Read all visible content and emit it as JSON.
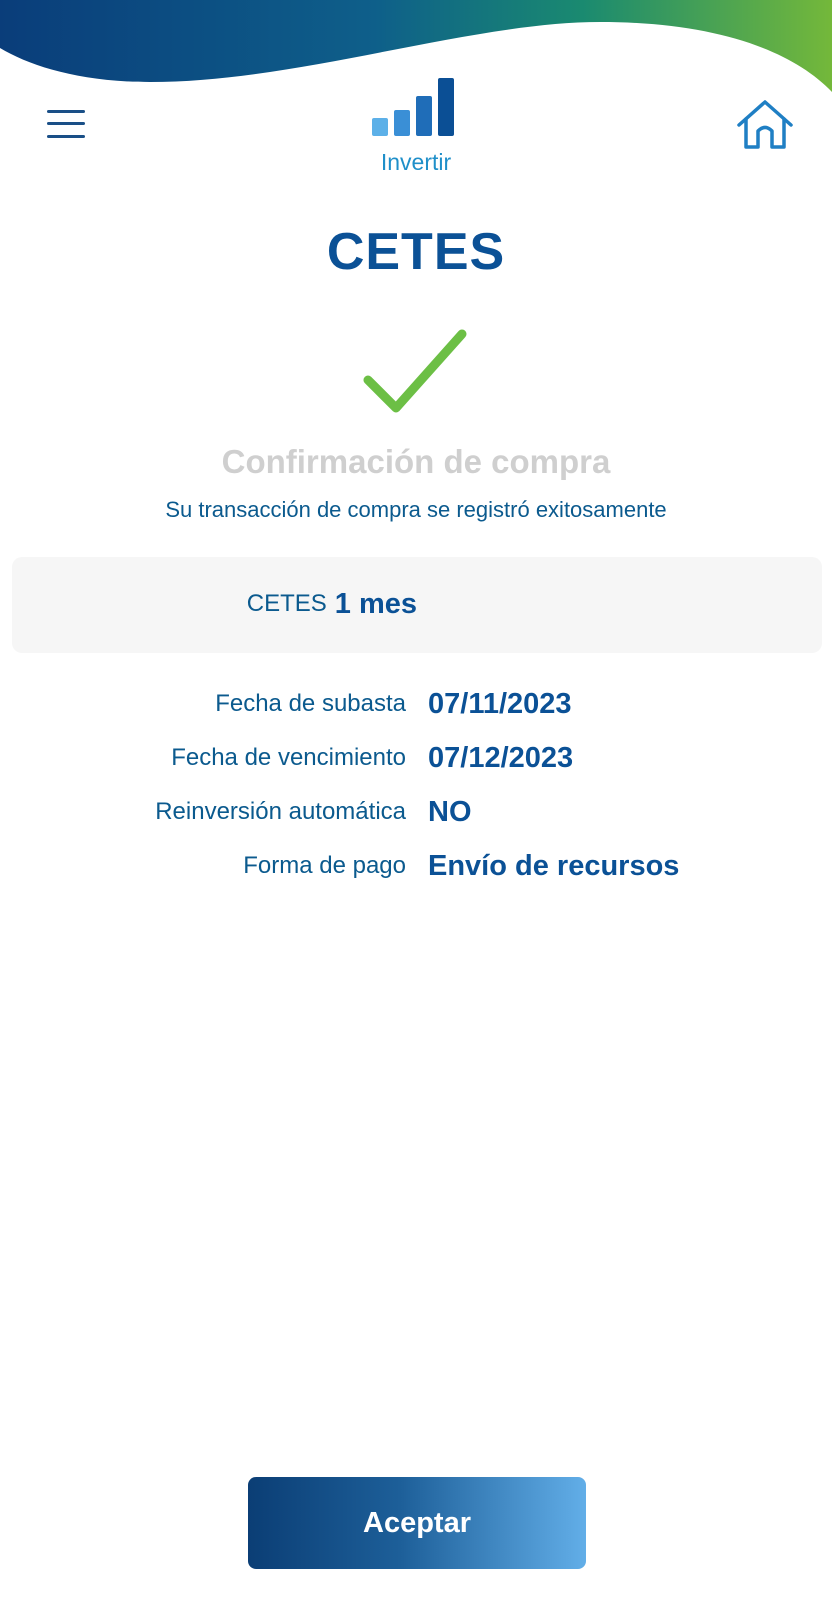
{
  "header": {
    "app_label": "Invertir",
    "icons": {
      "menu": "hamburger-menu-icon",
      "logo": "bar-chart-icon",
      "home": "home-icon"
    }
  },
  "colors": {
    "primary_blue": "#0b5196",
    "text_blue": "#0b5a8e",
    "success_green": "#6cbf45",
    "wave_green": "#6db33f",
    "muted_gray": "#cfcfcf"
  },
  "title": "CETES",
  "confirmation": {
    "icon": "check-icon",
    "heading": "Confirmación de compra",
    "message": "Su transacción de compra se registró exitosamente"
  },
  "summary": {
    "label": "CETES",
    "term": "1 mes"
  },
  "details": [
    {
      "label": "Fecha de subasta",
      "value": "07/11/2023"
    },
    {
      "label": "Fecha de vencimiento",
      "value": "07/12/2023"
    },
    {
      "label": "Reinversión automática",
      "value": "NO"
    },
    {
      "label": "Forma de pago",
      "value": "Envío de recursos"
    }
  ],
  "actions": {
    "accept_label": "Aceptar"
  }
}
